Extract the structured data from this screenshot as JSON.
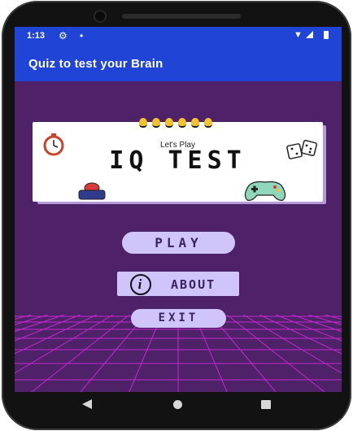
{
  "status_bar": {
    "time": "1:13",
    "icons": [
      "gear-icon",
      "notification-dot-icon",
      "wifi-icon",
      "signal-icon",
      "battery-icon"
    ]
  },
  "app_bar": {
    "title": "Quiz to test your Brain"
  },
  "banner": {
    "subtitle": "Let's Play",
    "title": "IQ TEST",
    "decorations": [
      "stopwatch-icon",
      "dice-icon",
      "buzzer-icon",
      "gamepad-icon",
      "light-bulbs"
    ]
  },
  "buttons": {
    "play": "PLAY",
    "about": "ABOUT",
    "about_icon": "i",
    "exit": "EXIT"
  },
  "nav_bar": {
    "icons": [
      "back-icon",
      "home-icon",
      "recents-icon"
    ]
  },
  "colors": {
    "app_bar": "#1f44d6",
    "background": "#4e2168",
    "button": "#cfc5fb",
    "grid_lines": "#d02ad8"
  }
}
